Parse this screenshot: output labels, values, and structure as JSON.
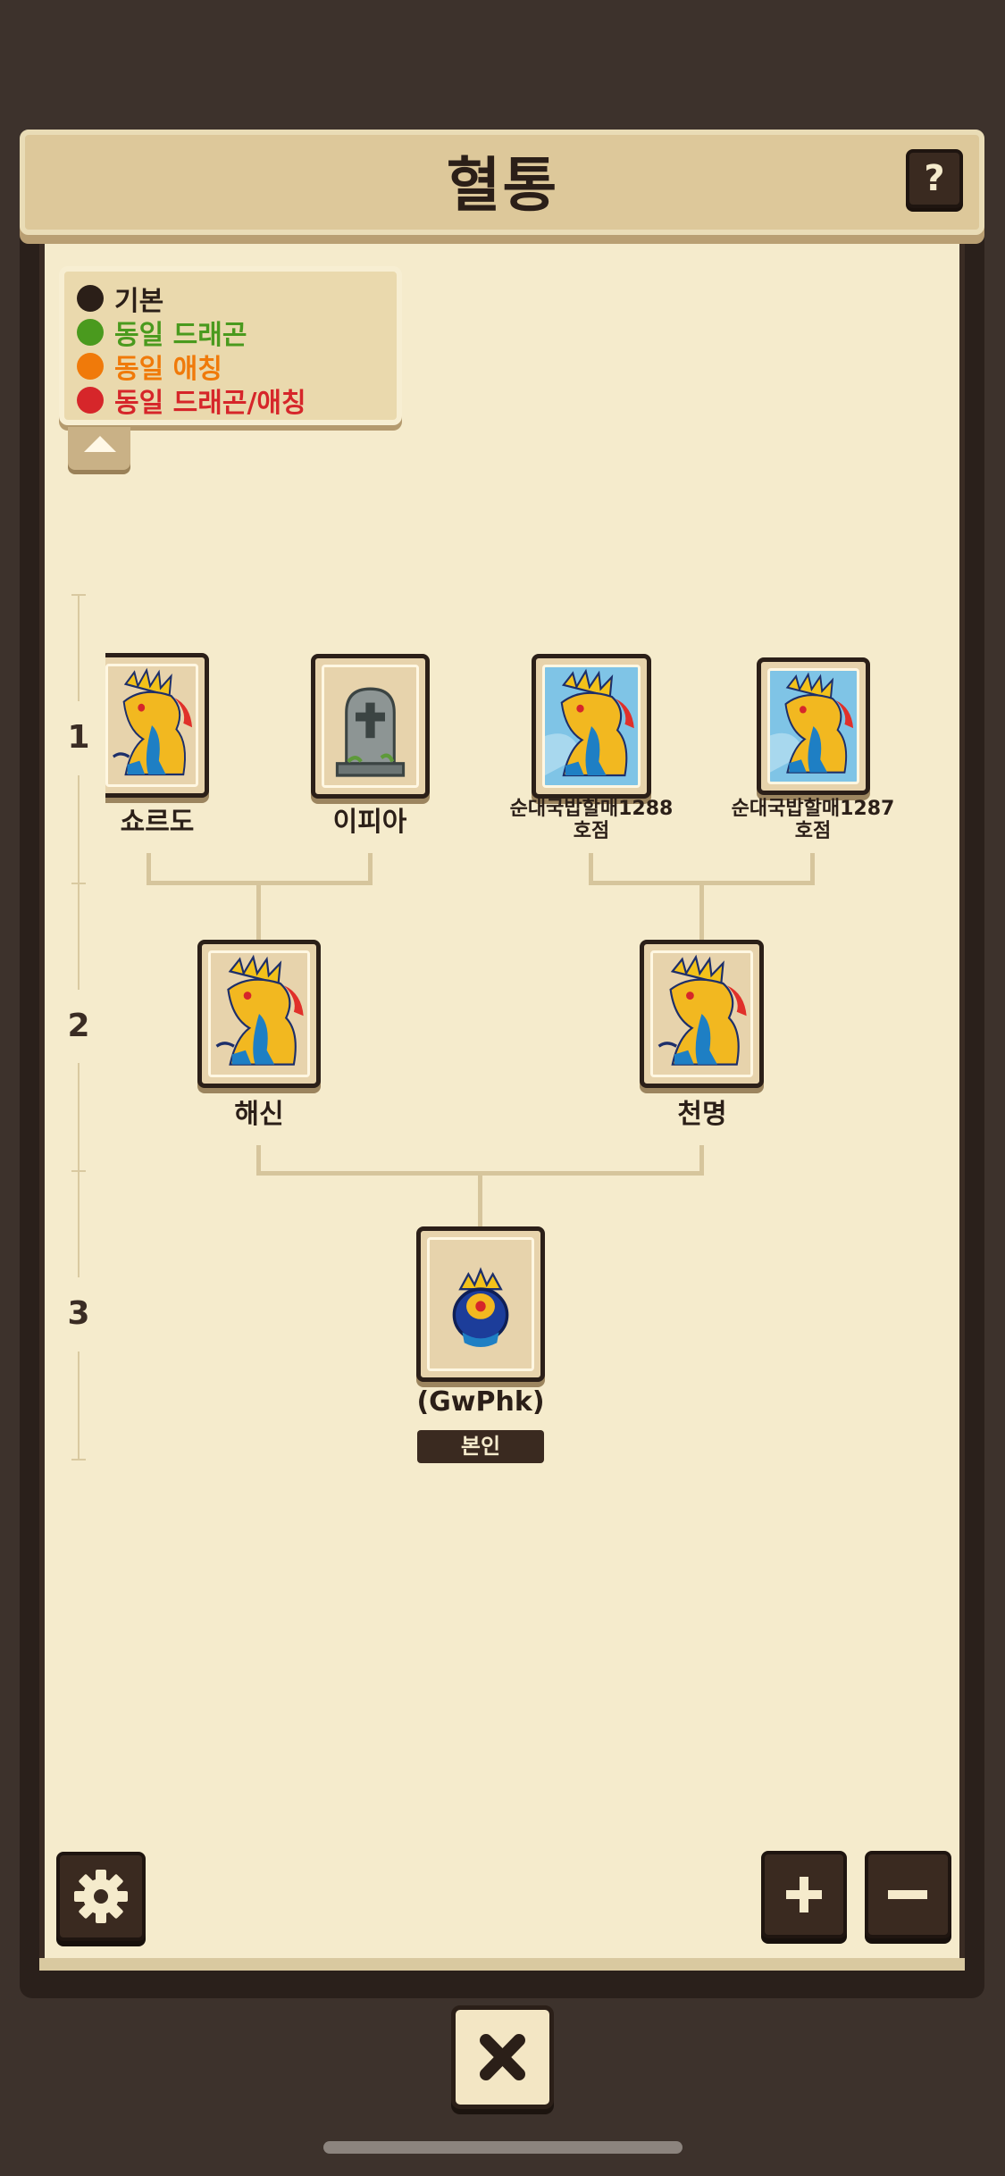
{
  "title": "혈통",
  "help_label": "?",
  "legend": {
    "items": [
      {
        "label": "기본",
        "color": "#2b1f18"
      },
      {
        "label": "동일 드래곤",
        "color": "#4a9a1e"
      },
      {
        "label": "동일 애칭",
        "color": "#f07a0a"
      },
      {
        "label": "동일 드래곤/애칭",
        "color": "#d6262a"
      }
    ]
  },
  "generations": [
    "1",
    "2",
    "3"
  ],
  "tree": {
    "gen1": [
      {
        "name": "쇼르도",
        "type": "dragon"
      },
      {
        "name": "이피아",
        "type": "tombstone"
      },
      {
        "name": "순대국밥할매1288\n호점",
        "name_line1": "순대국밥할매1288",
        "name_line2": "호점",
        "type": "dragon"
      },
      {
        "name_line1": "순대국밥할매1287",
        "name_line2": "호점",
        "type": "dragon"
      }
    ],
    "gen2": [
      {
        "name": "해신",
        "type": "dragon"
      },
      {
        "name": "천명",
        "type": "dragon"
      }
    ],
    "gen3": [
      {
        "name": "(GwPhk)",
        "badge": "본인",
        "type": "egg-dragon"
      }
    ]
  },
  "controls": {
    "settings": "gear-icon",
    "zoom_in": "+",
    "zoom_out": "−",
    "close": "close-icon"
  }
}
